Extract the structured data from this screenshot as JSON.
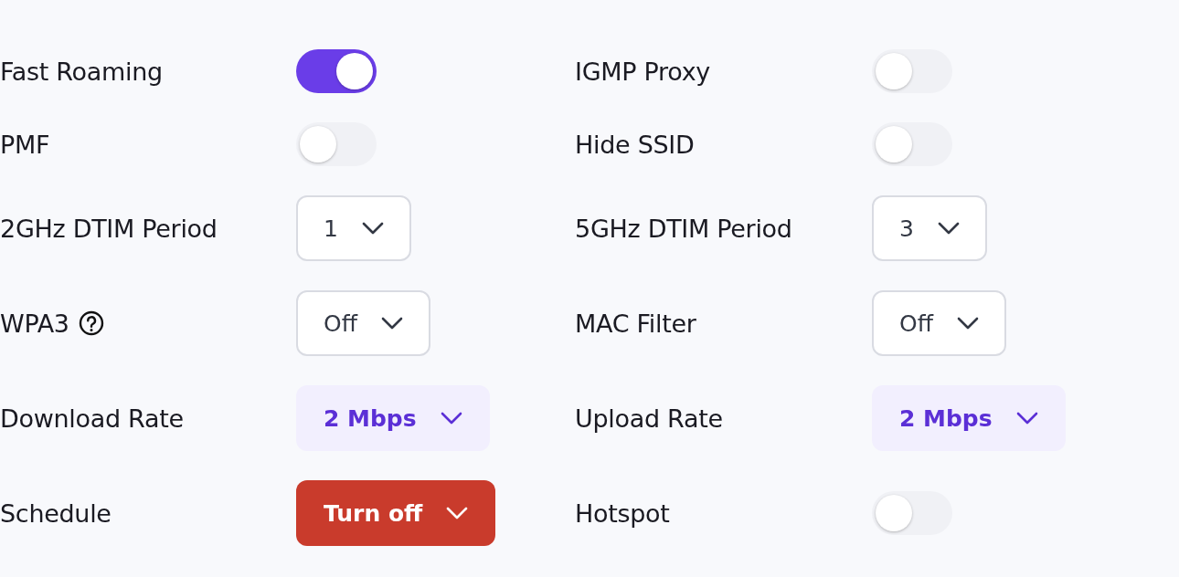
{
  "rows": [
    [
      {
        "label": "Fast Roaming",
        "kind": "toggle",
        "on": true
      },
      {
        "label": "IGMP Proxy",
        "kind": "toggle",
        "on": false
      }
    ],
    [
      {
        "label": "PMF",
        "kind": "toggle",
        "on": false
      },
      {
        "label": "Hide SSID",
        "kind": "toggle",
        "on": false
      }
    ],
    [
      {
        "label": "2GHz DTIM Period",
        "kind": "select",
        "value": "1"
      },
      {
        "label": "5GHz DTIM Period",
        "kind": "select",
        "value": "3"
      }
    ],
    [
      {
        "label": "WPA3",
        "help": true,
        "kind": "select",
        "value": "Off"
      },
      {
        "label": "MAC Filter",
        "kind": "select",
        "value": "Off"
      }
    ],
    [
      {
        "label": "Download Rate",
        "kind": "rate",
        "value": "2 Mbps"
      },
      {
        "label": "Upload Rate",
        "kind": "rate",
        "value": "2 Mbps"
      }
    ],
    [
      {
        "label": "Schedule",
        "kind": "action",
        "value": "Turn off"
      },
      {
        "label": "Hotspot",
        "kind": "toggle",
        "on": false
      }
    ]
  ]
}
